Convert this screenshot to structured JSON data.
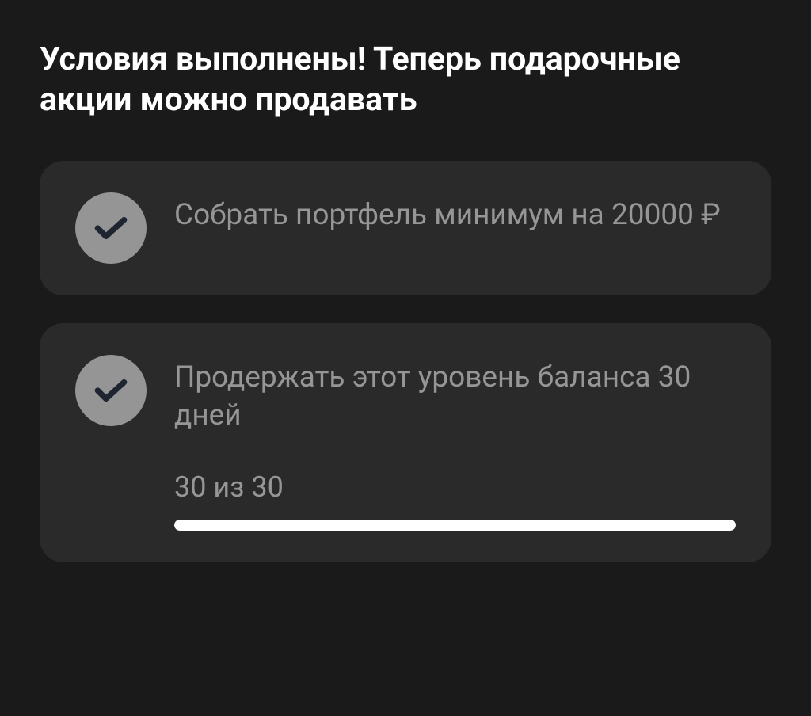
{
  "heading": "Условия выполнены! Теперь подарочные акции можно продавать",
  "conditions": {
    "portfolio": {
      "text": "Собрать портфель минимум на 20000 ₽",
      "completed": true
    },
    "balance": {
      "text": "Продержать этот уровень баланса 30 дней",
      "completed": true,
      "progress": {
        "label": "30 из 30",
        "current": 30,
        "total": 30,
        "percent": 100
      }
    }
  }
}
